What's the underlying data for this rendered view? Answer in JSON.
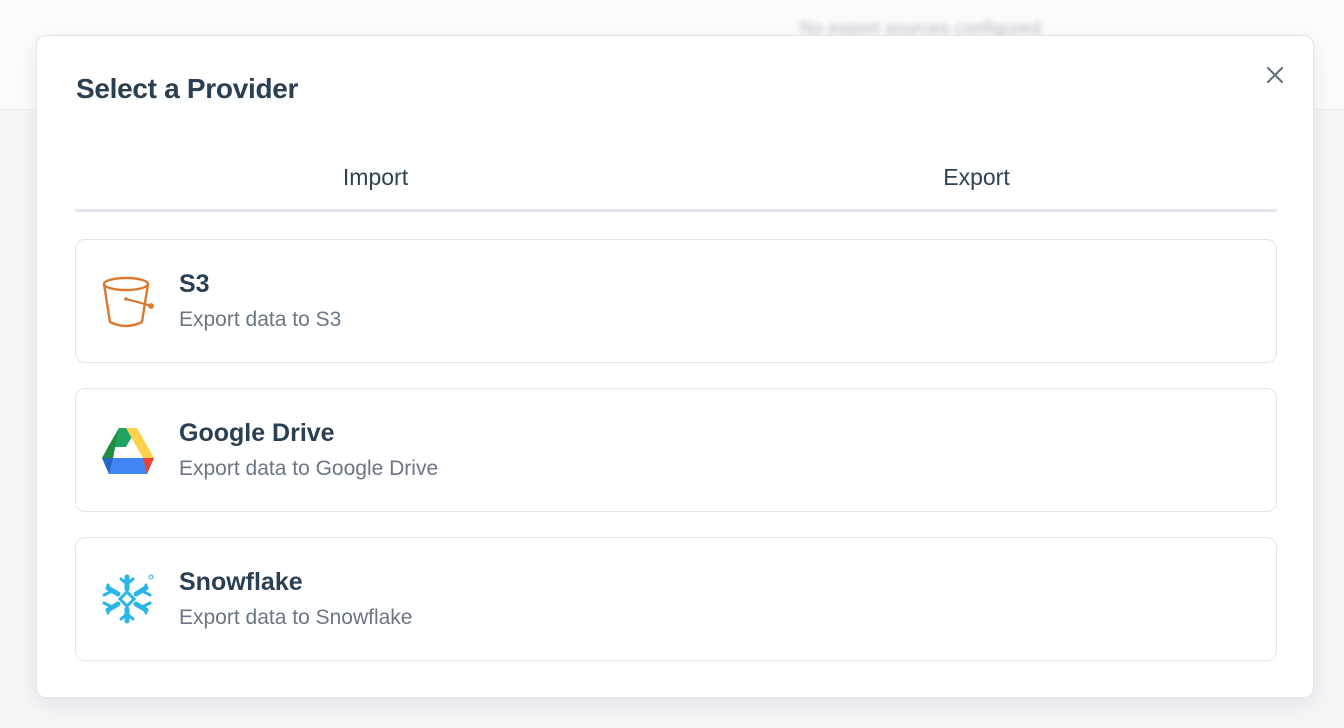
{
  "background": {
    "blurred_text": "No export sources configured"
  },
  "modal": {
    "title": "Select a Provider",
    "close_icon": "close-icon",
    "tabs": [
      {
        "label": "Import",
        "active": false
      },
      {
        "label": "Export",
        "active": true
      }
    ],
    "providers": [
      {
        "name": "S3",
        "description": "Export data to S3",
        "icon": "s3-bucket-icon",
        "color": "#d9782f"
      },
      {
        "name": "Google Drive",
        "description": "Export data to Google Drive",
        "icon": "google-drive-icon",
        "color": "#1fa463"
      },
      {
        "name": "Snowflake",
        "description": "Export data to Snowflake",
        "icon": "snowflake-icon",
        "color": "#29b5e8"
      }
    ]
  }
}
